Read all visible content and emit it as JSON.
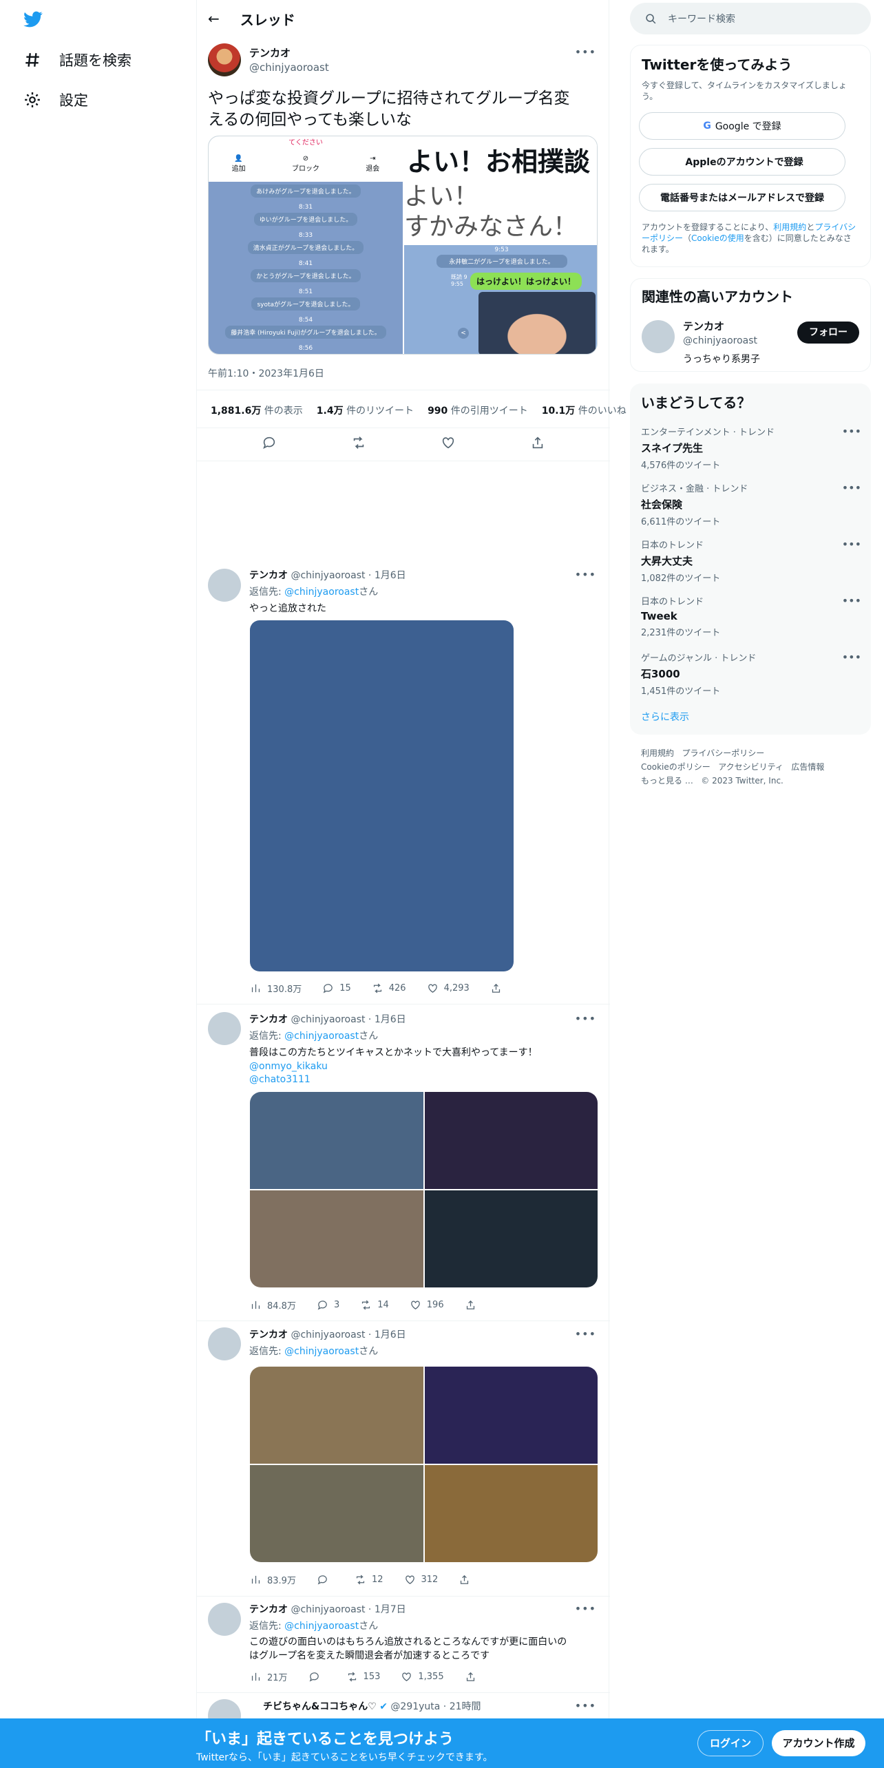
{
  "nav": {
    "explore_label": "話題を検索",
    "settings_label": "設定"
  },
  "header": {
    "title": "スレッド"
  },
  "main_tweet": {
    "name": "テンカオ",
    "handle": "@chinjyaoroast",
    "text_line1": "やっぱ変な投資グループに招待されてグループ名変",
    "text_line2": "えるの何回やっても楽しいな",
    "screenshot_left": {
      "top_text": "てください",
      "btn_add": "追加",
      "btn_block": "ブロック",
      "btn_leave": "退会",
      "messages": [
        "あけみがグループを退会しました。",
        "8:31",
        "ゆいがグループを退会しました。",
        "8:33",
        "清水貞正がグループを退会しました。",
        "8:41",
        "かとうがグループを退会しました。",
        "8:51",
        "syotaがグループを退会しました。",
        "8:54",
        "藤井浩幸 (Hiroyuki Fuji)がグループを退会しました。",
        "8:56"
      ]
    },
    "screenshot_right": {
      "big1": "よい！お相撲談",
      "big2": "よい！",
      "big3": "すかみなさん！",
      "time": "9:53",
      "sys": "永井敏二がグループを退会しました。",
      "read": "既読 9",
      "time2": "9:55",
      "bubble": "はっけよい！はっけよい！"
    },
    "timestamp": "午前1:10・2023年1月6日",
    "stats": [
      {
        "num": "1,881.6万",
        "label": "件の表示"
      },
      {
        "num": "1.4万",
        "label": "件のリツイート"
      },
      {
        "num": "990",
        "label": "件の引用ツイート"
      },
      {
        "num": "10.1万",
        "label": "件のいいね"
      }
    ]
  },
  "replies": [
    {
      "name": "テンカオ",
      "meta": "@chinjyaoroast · 1月6日",
      "reply_to": "返信先:",
      "reply_handle": "@chinjyaoroast",
      "reply_suffix": "さん",
      "text": "やっと追放された",
      "views": "130.8万",
      "comments": "15",
      "retweets": "426",
      "likes": "4,293"
    },
    {
      "name": "テンカオ",
      "meta": "@chinjyaoroast · 1月6日",
      "reply_to": "返信先:",
      "reply_handle": "@chinjyaoroast",
      "reply_suffix": "さん",
      "text": "普段はこの方たちとツイキャスとかネットで大喜利やってまーす！",
      "link1": "@onmyo_kikaku",
      "link2": "@chato3111",
      "views": "84.8万",
      "comments": "3",
      "retweets": "14",
      "likes": "196"
    },
    {
      "name": "テンカオ",
      "meta": "@chinjyaoroast · 1月6日",
      "reply_to": "返信先:",
      "reply_handle": "@chinjyaoroast",
      "reply_suffix": "さん",
      "views": "83.9万",
      "comments": "",
      "retweets": "12",
      "likes": "312"
    },
    {
      "name": "テンカオ",
      "meta": "@chinjyaoroast · 1月7日",
      "reply_to": "返信先:",
      "reply_handle": "@chinjyaoroast",
      "reply_suffix": "さん",
      "text1": "この遊びの面白いのはもちろん追放されるところなんですが更に面白いの",
      "text2": "はグループ名を変えた瞬間退会者が加速するところです",
      "views": "21万",
      "comments": "",
      "retweets": "153",
      "likes": "1,355"
    },
    {
      "name": "チビちゃん&ココちゃん♡",
      "meta": "@291yuta · 21時間"
    }
  ],
  "sidebar": {
    "search_placeholder": "キーワード検索",
    "signup": {
      "title": "Twitterを使ってみよう",
      "sub": "今すぐ登録して、タイムラインをカスタマイズしましょう。",
      "google": "Google で登録",
      "apple": "Appleのアカウントで登録",
      "phone": "電話番号またはメールアドレスで登録",
      "legal1": "アカウントを登録することにより、",
      "legal_terms": "利用規約",
      "legal2": "と",
      "legal_privacy": "プライバシーポリシー",
      "legal3": "（",
      "legal_cookie": "Cookieの使用",
      "legal4": "を含む）に同意したとみなされます。"
    },
    "related": {
      "title": "関連性の高いアカウント",
      "name": "テンカオ",
      "handle": "@chinjyaoroast",
      "bio": "うっちゃり系男子",
      "follow": "フォロー"
    },
    "trends": {
      "title": "いまどうしてる？",
      "items": [
        {
          "cat": "エンターテインメント · トレンド",
          "name": "スネイプ先生",
          "count": "4,576件のツイート"
        },
        {
          "cat": "ビジネス・金融 · トレンド",
          "name": "社会保険",
          "count": "6,611件のツイート"
        },
        {
          "cat": "日本のトレンド",
          "name": "大昇大丈夫",
          "count": "1,082件のツイート"
        },
        {
          "cat": "日本のトレンド",
          "name": "Tweek",
          "count": "2,231件のツイート"
        },
        {
          "cat": "ゲームのジャンル · トレンド",
          "name": "石3000",
          "count": "1,451件のツイート"
        }
      ],
      "more": "さらに表示"
    },
    "footer": {
      "terms": "利用規約",
      "privacy": "プライバシーポリシー",
      "cookie": "Cookieのポリシー",
      "access": "アクセシビリティ",
      "ads": "広告情報",
      "more": "もっと見る …",
      "copy": "© 2023 Twitter, Inc."
    }
  },
  "bottom": {
    "title": "「いま」起きていることを見つけよう",
    "sub": "Twitterなら、「いま」起きていることをいち早くチェックできます。",
    "login": "ログイン",
    "signup": "アカウント作成"
  },
  "colors": {
    "accent": "#1d9bf0",
    "media1": "#3d6091",
    "q1": [
      "#4a6584",
      "#2a2340",
      "#807060",
      "#1e2a36"
    ],
    "q2": [
      "#8a7555",
      "#2a2455",
      "#6e6a58",
      "#8a6a3a"
    ]
  }
}
